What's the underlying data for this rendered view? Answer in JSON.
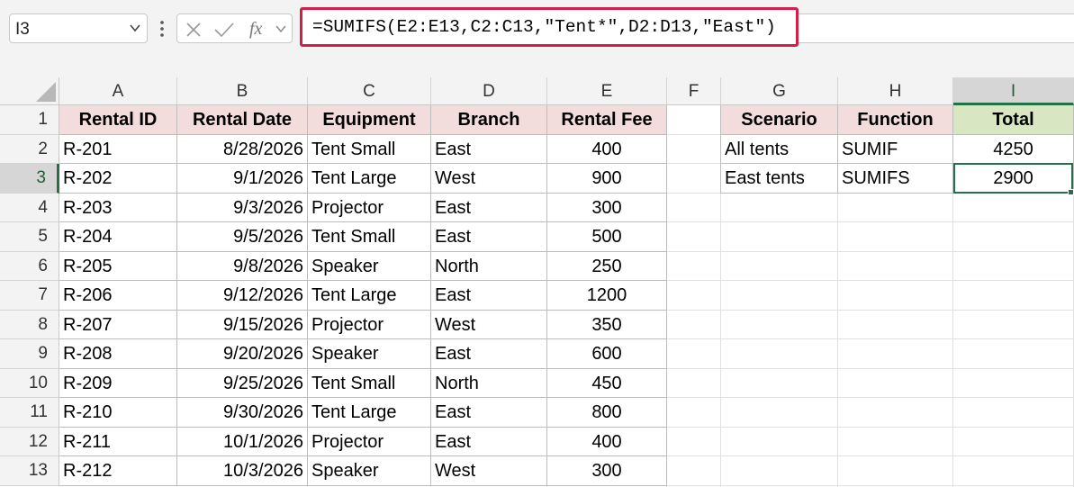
{
  "namebox": {
    "value": "I3"
  },
  "formula": {
    "text": "=SUMIFS(E2:E13,C2:C13,\"Tent*\",D2:D13,\"East\")"
  },
  "columns": [
    "A",
    "B",
    "C",
    "D",
    "E",
    "F",
    "G",
    "H",
    "I"
  ],
  "selected_column": "I",
  "selected_row": "3",
  "rows": [
    "1",
    "2",
    "3",
    "4",
    "5",
    "6",
    "7",
    "8",
    "9",
    "10",
    "11",
    "12",
    "13"
  ],
  "main_table": {
    "headers": [
      "Rental ID",
      "Rental Date",
      "Equipment",
      "Branch",
      "Rental Fee"
    ],
    "data": [
      [
        "R-201",
        "8/28/2026",
        "Tent Small",
        "East",
        "400"
      ],
      [
        "R-202",
        "9/1/2026",
        "Tent Large",
        "West",
        "900"
      ],
      [
        "R-203",
        "9/3/2026",
        "Projector",
        "East",
        "300"
      ],
      [
        "R-204",
        "9/5/2026",
        "Tent Small",
        "East",
        "500"
      ],
      [
        "R-205",
        "9/8/2026",
        "Speaker",
        "North",
        "250"
      ],
      [
        "R-206",
        "9/12/2026",
        "Tent Large",
        "East",
        "1200"
      ],
      [
        "R-207",
        "9/15/2026",
        "Projector",
        "West",
        "350"
      ],
      [
        "R-208",
        "9/20/2026",
        "Speaker",
        "East",
        "600"
      ],
      [
        "R-209",
        "9/25/2026",
        "Tent Small",
        "North",
        "450"
      ],
      [
        "R-210",
        "9/30/2026",
        "Tent Large",
        "East",
        "800"
      ],
      [
        "R-211",
        "10/1/2026",
        "Projector",
        "East",
        "400"
      ],
      [
        "R-212",
        "10/3/2026",
        "Speaker",
        "West",
        "300"
      ]
    ]
  },
  "summary_table": {
    "headers": [
      "Scenario",
      "Function",
      "Total"
    ],
    "data": [
      [
        "All tents",
        "SUMIF",
        "4250"
      ],
      [
        "East tents",
        "SUMIFS",
        "2900"
      ]
    ]
  },
  "colors": {
    "accent_green": "#217346",
    "formula_highlight": "#d21f4a",
    "header_pink": "#f2dcdc",
    "header_green": "#d8e6c2"
  }
}
